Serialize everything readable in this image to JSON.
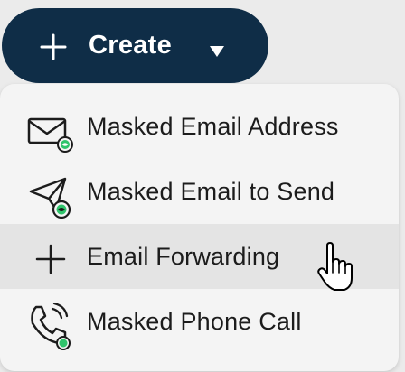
{
  "create_button": {
    "label": "Create",
    "icon": "plus-icon",
    "caret_icon": "caret-down-icon"
  },
  "menu": {
    "items": [
      {
        "label": "Masked Email Address",
        "icon": "masked-email-address-icon"
      },
      {
        "label": "Masked Email to Send",
        "icon": "send-masked-email-icon"
      },
      {
        "label": "Email Forwarding",
        "icon": "plus-icon",
        "hovered": true
      },
      {
        "label": "Masked Phone Call",
        "icon": "masked-phone-call-icon"
      }
    ]
  },
  "colors": {
    "button_bg": "#0f2d47",
    "menu_bg": "#f4f4f4",
    "hover_bg": "#e4e4e4",
    "accent_green": "#2fc46b",
    "text": "#1c1c1c"
  },
  "cursor": "hand-pointer-icon"
}
